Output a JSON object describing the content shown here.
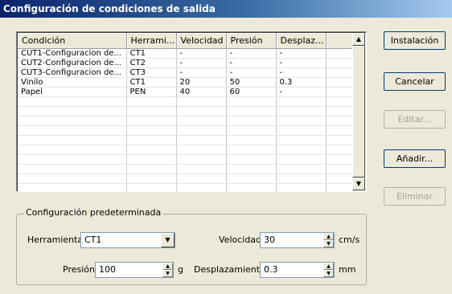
{
  "window": {
    "title": "Configuración de condiciones de salida"
  },
  "grid": {
    "columns": [
      "Condición",
      "Herrami...",
      "Velocidad",
      "Presión",
      "Desplaz...",
      ""
    ],
    "rows": [
      [
        "CUT1-Configuracion de...",
        "CT1",
        "-",
        "-",
        "-",
        ""
      ],
      [
        "CUT2-Configuracion de...",
        "CT2",
        "-",
        "-",
        "-",
        ""
      ],
      [
        "CUT3-Configuracion de...",
        "CT3",
        "-",
        "-",
        "-",
        ""
      ],
      [
        "Vinilo",
        "CT1",
        "20",
        "50",
        "0.3",
        ""
      ],
      [
        "Papel",
        "PEN",
        "40",
        "60",
        "-",
        ""
      ]
    ],
    "empty_rows": 11
  },
  "buttons": {
    "install": "Instalación",
    "cancel": "Cancelar",
    "edit": "Editar...",
    "add": "Añadir...",
    "delete": "Eliminar"
  },
  "defaults": {
    "title": "Configuración predeterminada",
    "tool_label": "Herramienta",
    "tool_value": "CT1",
    "speed_label": "Velocidad",
    "speed_value": "30",
    "speed_unit": "cm/s",
    "pressure_label": "Presión",
    "pressure_value": "100",
    "pressure_unit": "g",
    "offset_label": "Desplazamiento",
    "offset_value": "0.3",
    "offset_unit": "mm"
  },
  "icons": {
    "scroll_up": "▲",
    "scroll_down": "▼",
    "dropdown": "▼",
    "spin_up": "▲",
    "spin_down": "▼"
  }
}
